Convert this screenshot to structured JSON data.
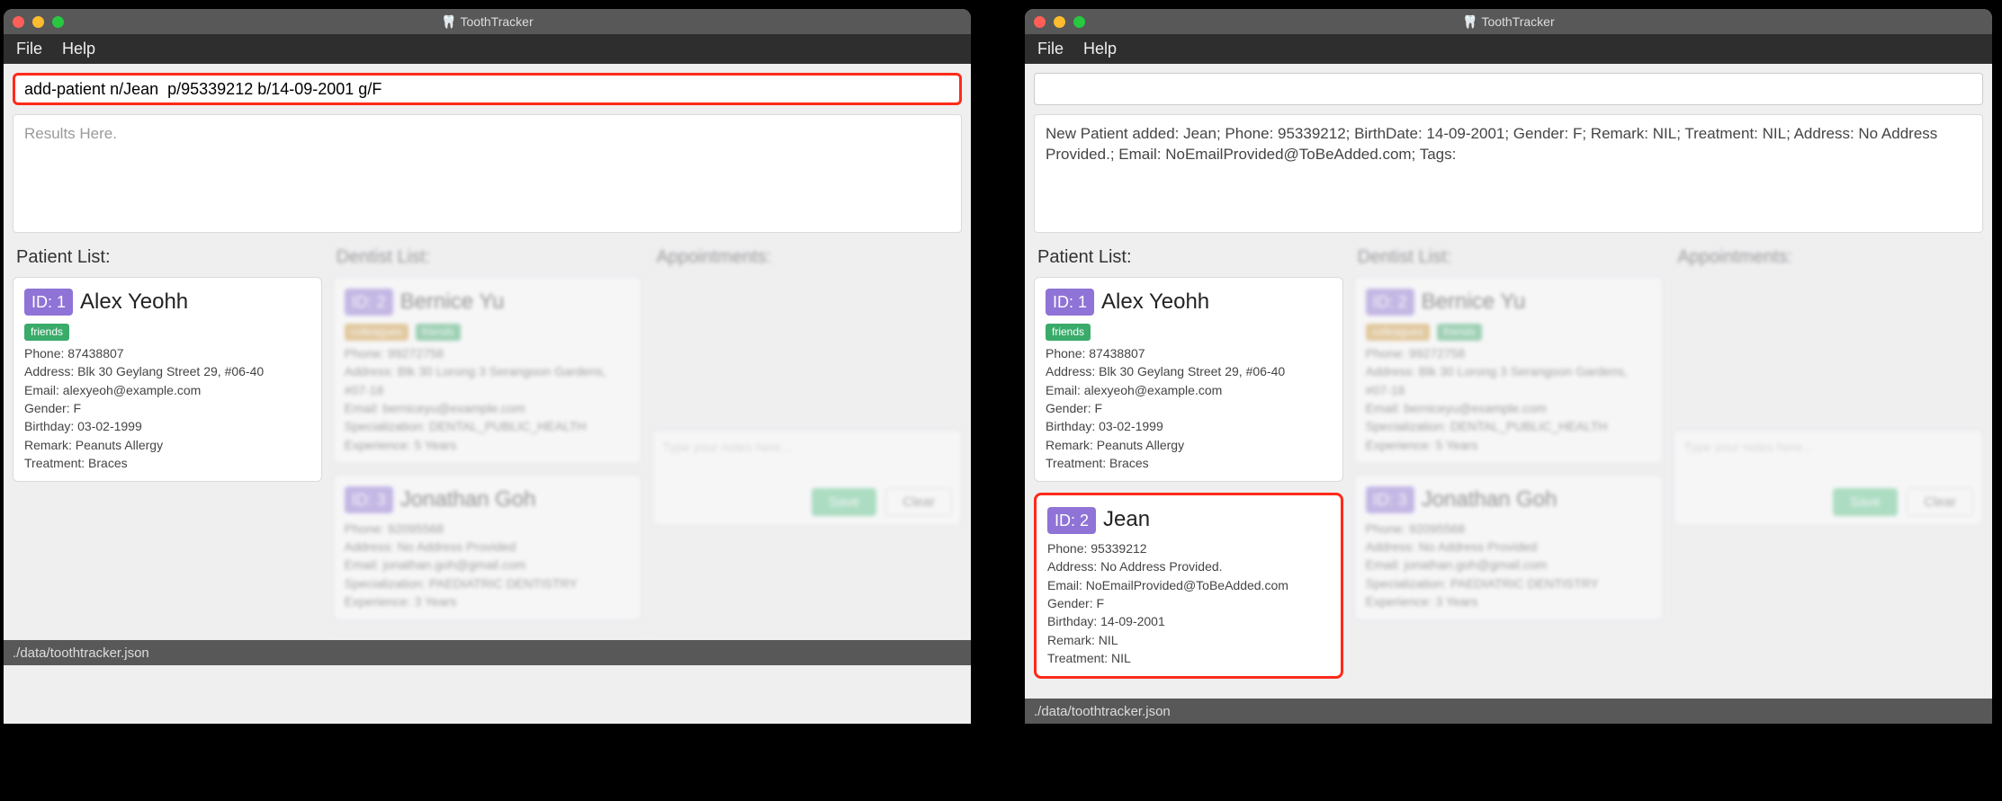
{
  "app": {
    "title": "ToothTracker",
    "icon_glyph": "🦷"
  },
  "menu": {
    "file": "File",
    "help": "Help"
  },
  "status_bar": "./data/toothtracker.json",
  "left": {
    "command_value": "add-patient n/Jean  p/95339212 b/14-09-2001 g/F",
    "result_placeholder": "Results Here."
  },
  "right": {
    "command_value": "",
    "result_text": "New Patient added: Jean; Phone: 95339212; BirthDate: 14-09-2001; Gender: F; Remark: NIL; Treatment: NIL; Address: No Address Provided.; Email: NoEmailProvided@ToBeAdded.com; Tags:"
  },
  "columns": {
    "patients": "Patient List:",
    "dentists": "Dentist List:",
    "appointments": "Appointments:"
  },
  "patient1": {
    "id": "ID: 1",
    "name": "Alex Yeohh",
    "tag_friends": "friends",
    "phone": "Phone: 87438807",
    "address": "Address: Blk 30 Geylang Street 29, #06-40",
    "email": "Email: alexyeoh@example.com",
    "gender": "Gender: F",
    "birthday": "Birthday: 03-02-1999",
    "remark": "Remark: Peanuts Allergy",
    "treatment": "Treatment: Braces"
  },
  "patient2": {
    "id": "ID: 2",
    "name": "Jean",
    "phone": "Phone: 95339212",
    "address": "Address: No Address Provided.",
    "email": "Email: NoEmailProvided@ToBeAdded.com",
    "gender": "Gender: F",
    "birthday": "Birthday: 14-09-2001",
    "remark": "Remark: NIL",
    "treatment": "Treatment: NIL"
  },
  "dentist1": {
    "id": "ID: 2",
    "name": "Bernice Yu",
    "tag_a": "colleagues",
    "tag_b": "friends",
    "phone": "Phone: 99272758",
    "address": "Address: Blk 30 Lorong 3 Serangoon Gardens, #07-18",
    "email": "Email: berniceyu@example.com",
    "spec": "Specialization: DENTAL_PUBLIC_HEALTH",
    "exp": "Experience: 5 Years"
  },
  "dentist2": {
    "id": "ID: 3",
    "name": "Jonathan Goh",
    "phone": "Phone: 92095568",
    "address": "Address: No Address Provided",
    "email": "Email: jonathan.goh@gmail.com",
    "spec": "Specialization: PAEDIATRIC DENTISTRY",
    "exp": "Experience: 3 Years"
  },
  "notes": {
    "placeholder": "Type your notes here...",
    "save": "Save",
    "clear": "Clear"
  }
}
